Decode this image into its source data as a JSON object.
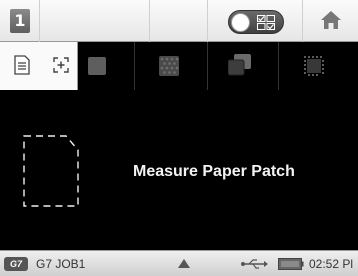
{
  "toolbar": {
    "job_number_icon_text": "1",
    "toggle_icon": "toggle-switch-with-grid",
    "home_icon": "home"
  },
  "tabs": {
    "items": [
      {
        "icon": "document-icon",
        "selected": true
      },
      {
        "icon": "crosshair-icon",
        "selected": true
      },
      {
        "icon": "paper-patch-icon",
        "selected": false
      },
      {
        "icon": "textured-patch-icon",
        "selected": false
      },
      {
        "icon": "overlap-patches-icon",
        "selected": false
      },
      {
        "icon": "dotted-patch-icon",
        "selected": false
      }
    ]
  },
  "main": {
    "instruction": "Measure Paper Patch"
  },
  "status": {
    "g7_badge": "G7",
    "job_label": "G7 JOB1",
    "time": "02:52 Pl"
  },
  "colors": {
    "background": "#000000",
    "toolbar": "#eeeeee",
    "text": "#f2f2f2"
  }
}
